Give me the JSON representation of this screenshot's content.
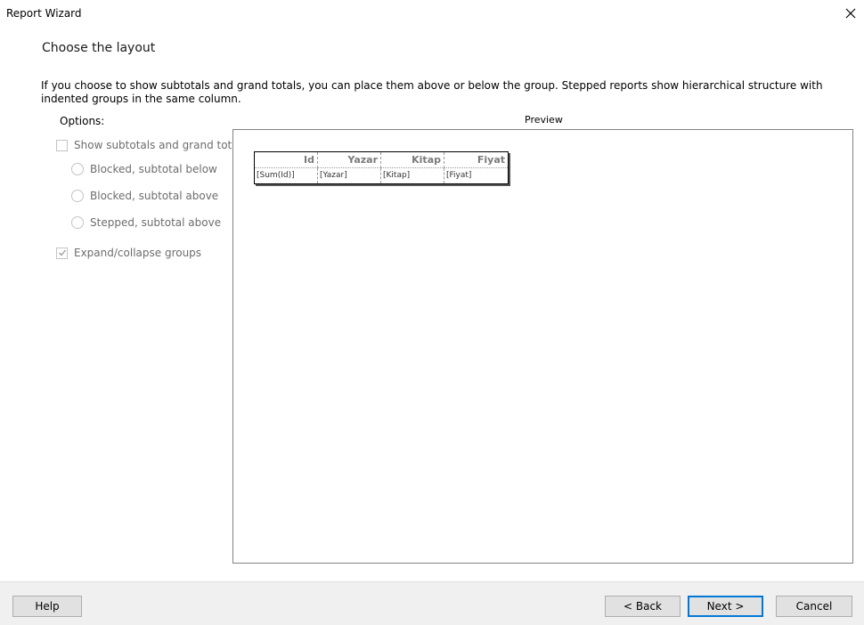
{
  "window": {
    "title": "Report Wizard",
    "close_icon": "close-icon"
  },
  "page": {
    "heading": "Choose the layout",
    "description": "If you choose to show subtotals and grand totals, you can place them above or below the group. Stepped reports show hierarchical structure with indented groups in the same column."
  },
  "options": {
    "label": "Options:",
    "show_subtotals": {
      "label": "Show subtotals and grand totals",
      "checked": false,
      "enabled": false
    },
    "radios": [
      {
        "label": "Blocked, subtotal below",
        "selected": false,
        "enabled": false
      },
      {
        "label": "Blocked, subtotal above",
        "selected": false,
        "enabled": false
      },
      {
        "label": "Stepped, subtotal above",
        "selected": false,
        "enabled": false
      }
    ],
    "expand_collapse": {
      "label": "Expand/collapse groups",
      "checked": true,
      "enabled": false
    }
  },
  "preview": {
    "label": "Preview",
    "table": {
      "headers": [
        "Id",
        "Yazar",
        "Kitap",
        "Fiyat"
      ],
      "row": [
        "[Sum(Id)]",
        "[Yazar]",
        "[Kitap]",
        "[Fiyat]"
      ]
    }
  },
  "footer": {
    "help": "Help",
    "back": "< Back",
    "next": "Next >",
    "cancel": "Cancel"
  },
  "colors": {
    "accent": "#0078d7",
    "disabled_text": "#6d6d6d",
    "footer_bg": "#f0f0f0"
  }
}
